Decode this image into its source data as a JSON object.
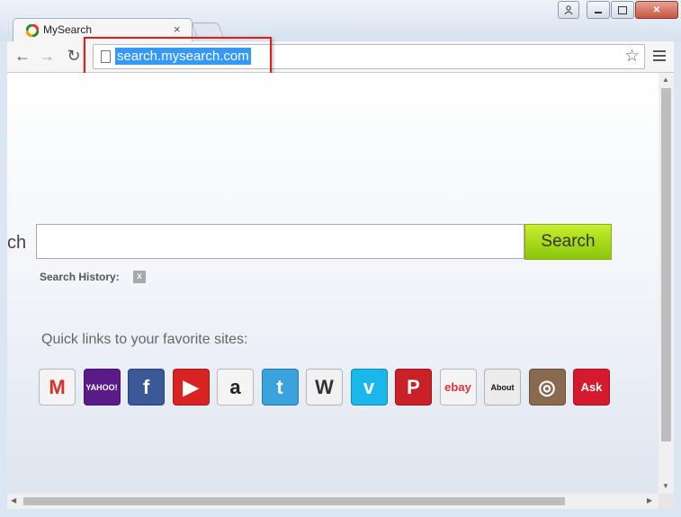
{
  "window": {
    "controls": [
      "user",
      "minimize",
      "maximize",
      "close"
    ]
  },
  "tab": {
    "title": "MySearch",
    "close": "×"
  },
  "toolbar": {
    "back": "←",
    "forward": "→",
    "reload": "↻",
    "url": "search.mysearch.com",
    "star": "☆"
  },
  "page": {
    "search_label": "ch",
    "search_button": "Search",
    "history_label": "Search History:",
    "history_clear": "x",
    "quick_links_title": "Quick links to your favorite sites:",
    "quick_links": [
      {
        "name": "Gmail",
        "glyph": "M",
        "bg": "#f4f4f4",
        "fg": "#d93025"
      },
      {
        "name": "Yahoo",
        "glyph": "YAHOO!",
        "bg": "#5b1a8a",
        "fg": "#ffffff"
      },
      {
        "name": "Facebook",
        "glyph": "f",
        "bg": "#3b5998",
        "fg": "#ffffff"
      },
      {
        "name": "YouTube",
        "glyph": "▶",
        "bg": "#d92323",
        "fg": "#ffffff"
      },
      {
        "name": "Amazon",
        "glyph": "a",
        "bg": "#f4f4f4",
        "fg": "#222222"
      },
      {
        "name": "Twitter",
        "glyph": "t",
        "bg": "#3aa2dc",
        "fg": "#ffffff"
      },
      {
        "name": "Wikipedia",
        "glyph": "W",
        "bg": "#f1f1f1",
        "fg": "#333333"
      },
      {
        "name": "Vimeo",
        "glyph": "v",
        "bg": "#1ab7ea",
        "fg": "#ffffff"
      },
      {
        "name": "Pinterest",
        "glyph": "P",
        "bg": "#cb2027",
        "fg": "#ffffff"
      },
      {
        "name": "eBay",
        "glyph": "ebay",
        "bg": "#f4f4f4",
        "fg": "#e53238"
      },
      {
        "name": "About",
        "glyph": "About",
        "bg": "#ececec",
        "fg": "#111111"
      },
      {
        "name": "Instagram",
        "glyph": "◎",
        "bg": "#8a6a4f",
        "fg": "#ffffff"
      },
      {
        "name": "Ask",
        "glyph": "Ask",
        "bg": "#d7192d",
        "fg": "#ffffff"
      }
    ]
  },
  "colors": {
    "highlight": "#e01b1b",
    "search_button": "#9ed50f",
    "url_selection": "#3399ff"
  }
}
